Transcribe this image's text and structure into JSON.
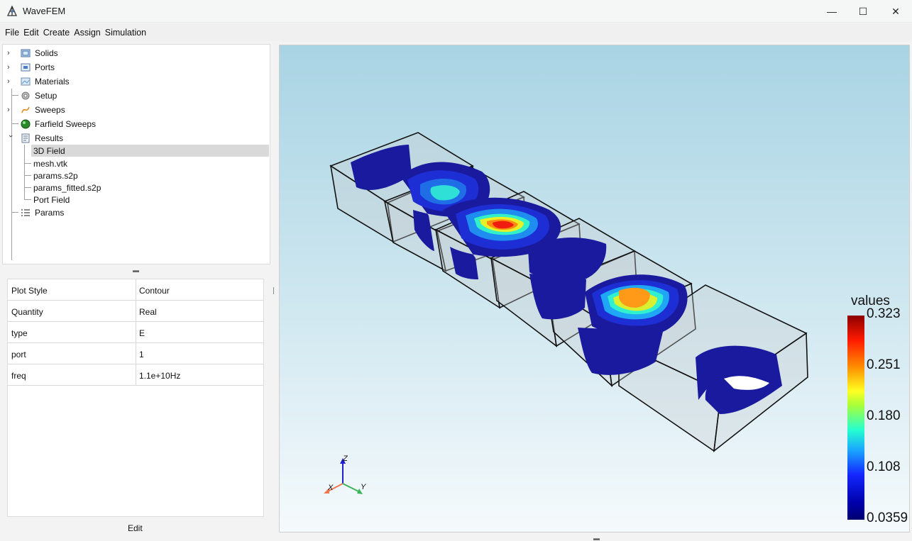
{
  "window": {
    "title": "WaveFEM",
    "minimize_glyph": "—",
    "maximize_glyph": "☐",
    "close_glyph": "✕"
  },
  "menu": [
    "File",
    "Edit",
    "Create",
    "Assign",
    "Simulation"
  ],
  "tree": {
    "items": [
      {
        "label": "Solids",
        "icon": "solids-icon",
        "expandable": true
      },
      {
        "label": "Ports",
        "icon": "ports-icon",
        "expandable": true
      },
      {
        "label": "Materials",
        "icon": "materials-icon",
        "expandable": true
      },
      {
        "label": "Setup",
        "icon": "gear-icon",
        "expandable": false
      },
      {
        "label": "Sweeps",
        "icon": "sweeps-icon",
        "expandable": true
      },
      {
        "label": "Farfield Sweeps",
        "icon": "globe-icon",
        "expandable": false
      },
      {
        "label": "Results",
        "icon": "results-icon",
        "expandable": true,
        "expanded": true
      },
      {
        "label": "Params",
        "icon": "list-icon",
        "expandable": false
      }
    ],
    "results_children": [
      {
        "label": "3D Field",
        "selected": true
      },
      {
        "label": "mesh.vtk",
        "selected": false
      },
      {
        "label": "params.s2p",
        "selected": false
      },
      {
        "label": "params_fitted.s2p",
        "selected": false
      },
      {
        "label": "Port Field",
        "selected": false
      }
    ]
  },
  "properties": [
    {
      "key": "Plot Style",
      "value": "Contour"
    },
    {
      "key": "Quantity",
      "value": "Real"
    },
    {
      "key": "type",
      "value": "E"
    },
    {
      "key": "port",
      "value": "1"
    },
    {
      "key": "freq",
      "value": "1.1e+10Hz"
    }
  ],
  "edit_label": "Edit",
  "viewport": {
    "legend": {
      "title": "values",
      "ticks": [
        "0.323",
        "0.251",
        "0.180",
        "0.108",
        "0.0359"
      ]
    },
    "axes": {
      "x": "X",
      "y": "Y",
      "z": "Z"
    },
    "colors": {
      "x_axis": "#f07850",
      "y_axis": "#3cb45a",
      "z_axis": "#2020d0"
    }
  }
}
